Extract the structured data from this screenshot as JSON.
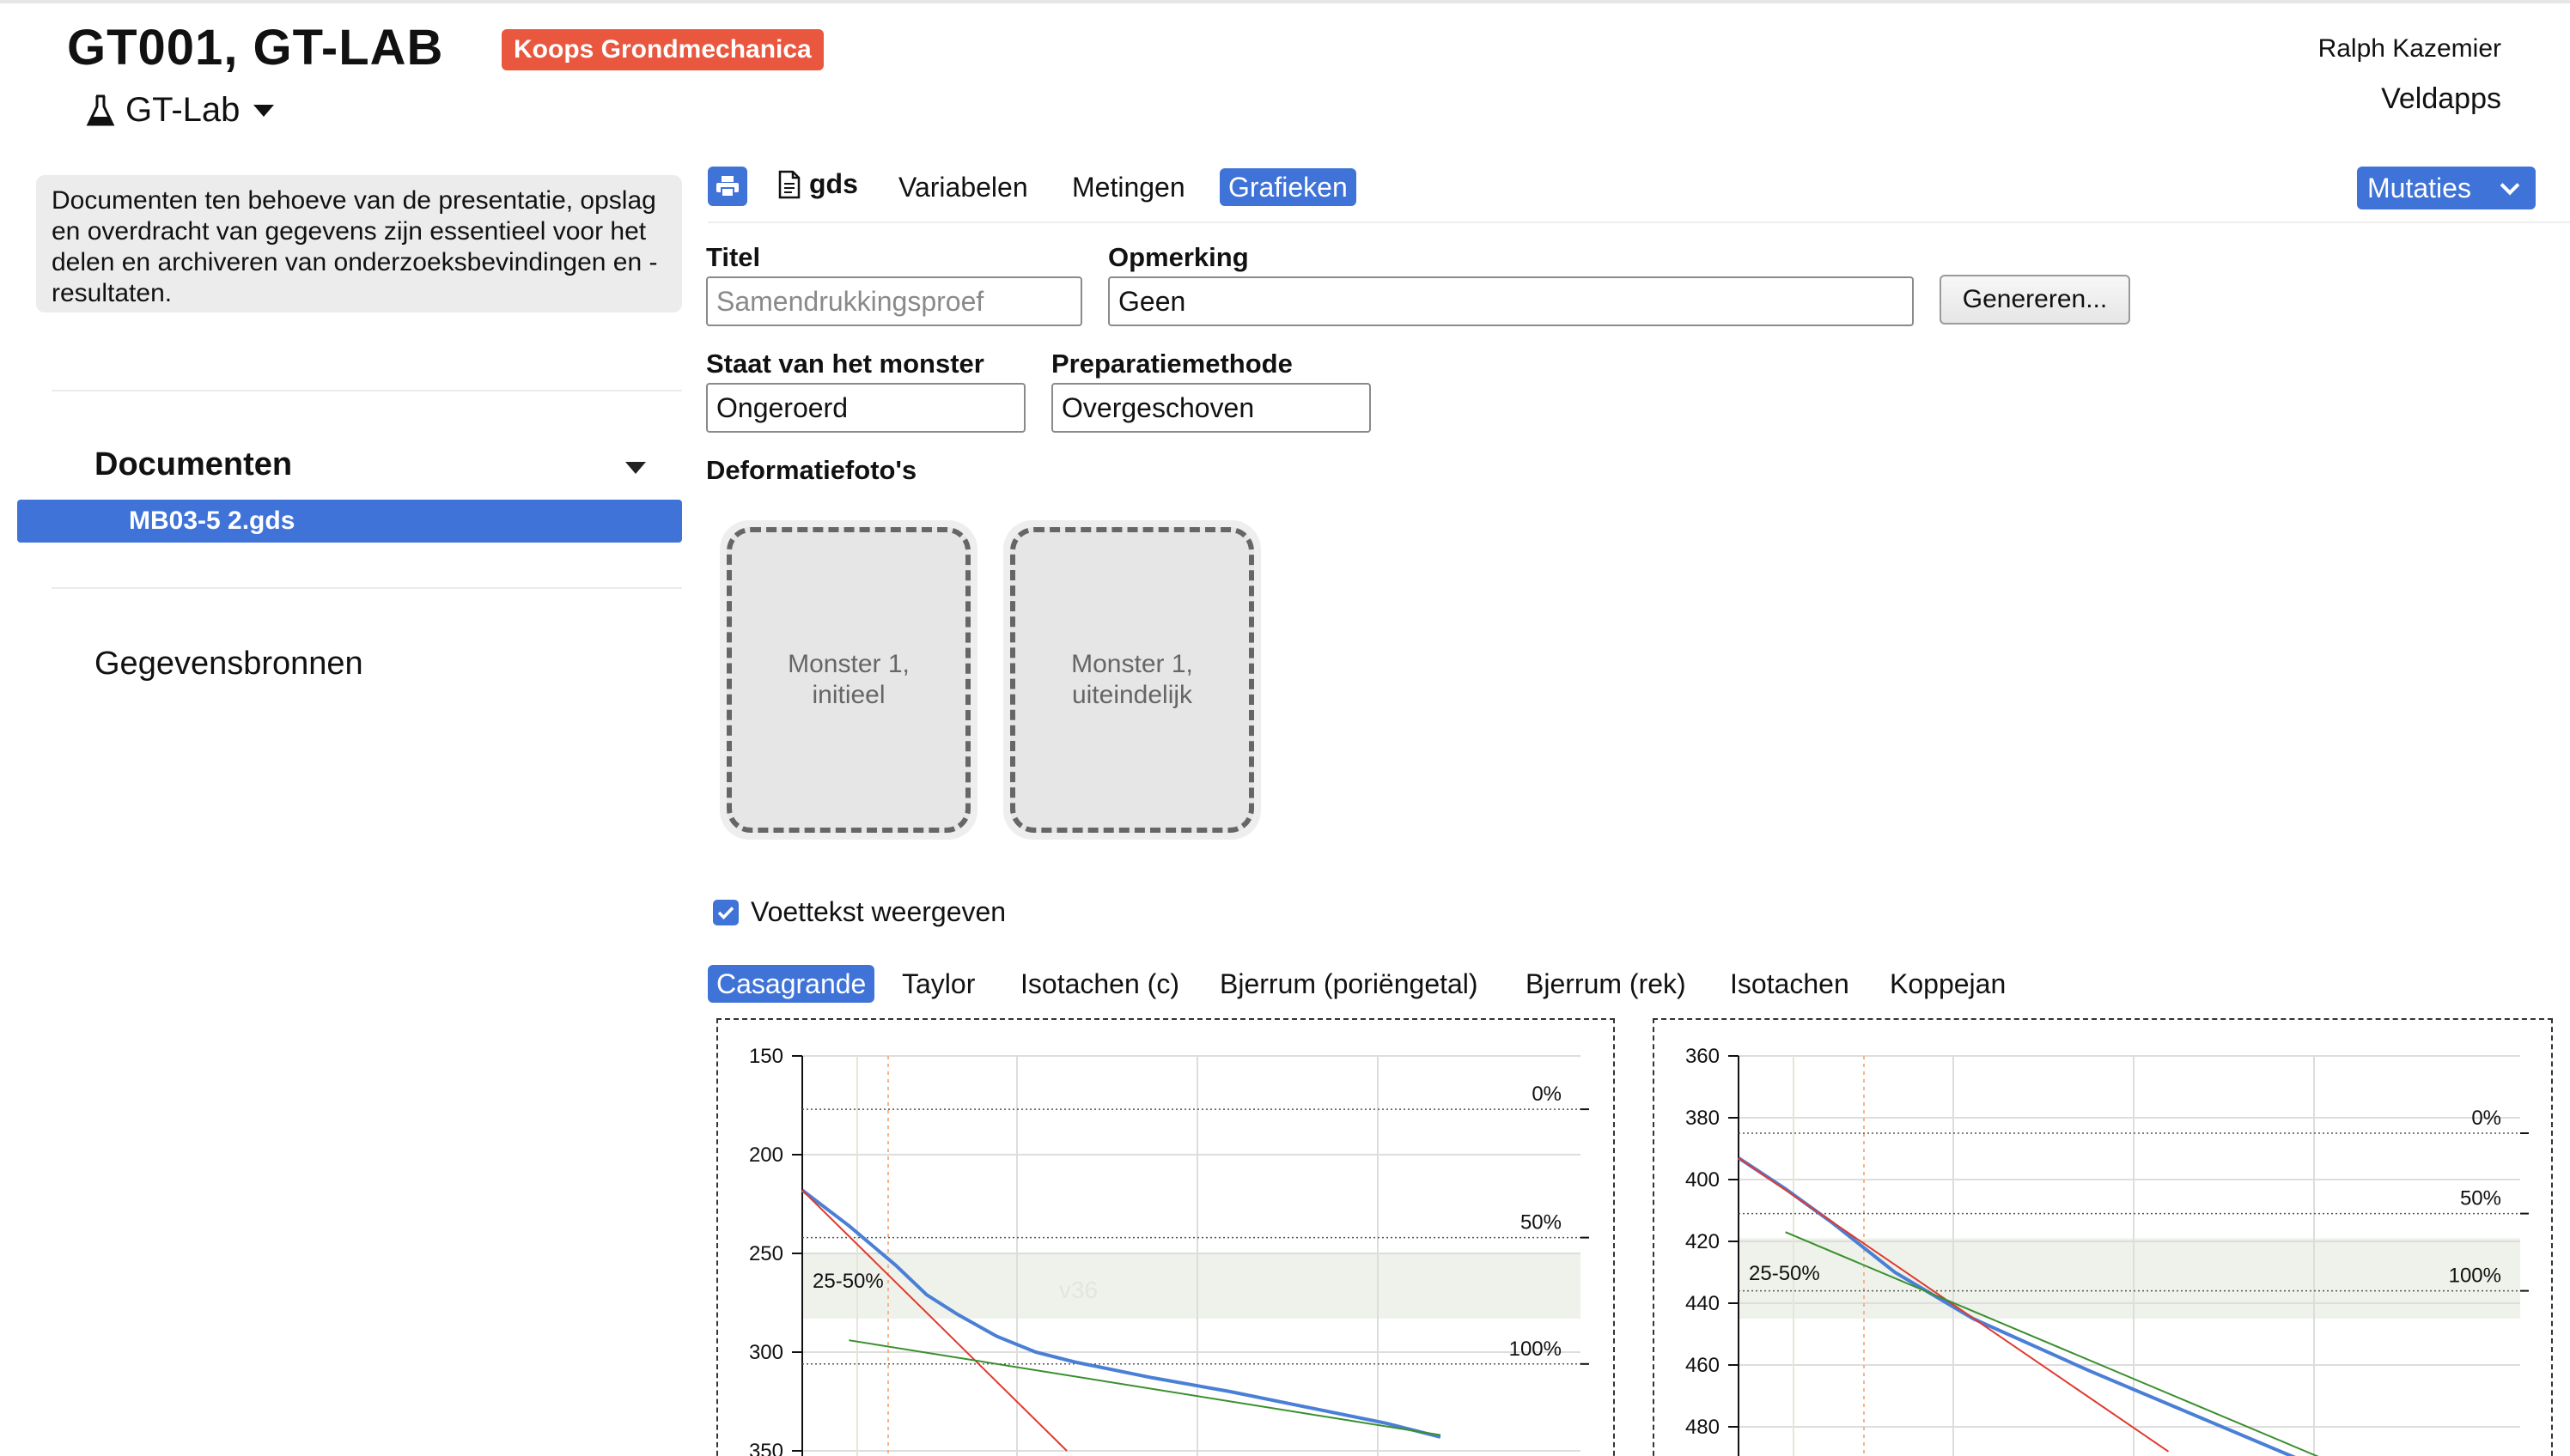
{
  "header": {
    "title": "GT001, GT-LAB",
    "badge": "Koops Grondmechanica",
    "module": "GT-Lab",
    "user": "Ralph Kazemier",
    "brand": "Veldapps"
  },
  "sidebar": {
    "info": "Documenten ten behoeve van de presentatie, opslag en overdracht van gegevens zijn essentieel voor het delen en archiveren van onderzoeksbevindingen en -resultaten.",
    "documents_header": "Documenten",
    "documents": [
      "MB03-5 2.gds"
    ],
    "sources": "Gegevensbronnen"
  },
  "toolbar": {
    "print_icon": "printer-icon",
    "file_tab": "gds",
    "tabs": [
      "Variabelen",
      "Metingen",
      "Grafieken"
    ],
    "active_tab": "Grafieken",
    "mutations": "Mutaties"
  },
  "form": {
    "title_label": "Titel",
    "title_placeholder": "Samendrukkingsproef",
    "remark_label": "Opmerking",
    "remark_value": "Geen",
    "generate_button": "Genereren...",
    "state_label": "Staat van het monster",
    "state_value": "Ongeroerd",
    "prep_label": "Preparatiemethode",
    "prep_value": "Overgeschoven",
    "photos_label": "Deformatiefoto's",
    "photos": [
      "Monster 1, initieel",
      "Monster 1, uiteindelijk"
    ],
    "footer_checkbox": "Voettekst weergeven",
    "footer_checked": true
  },
  "chart_tabs": {
    "items": [
      "Casagrande",
      "Taylor",
      "Isotachen (c)",
      "Bjerrum (poriëngetal)",
      "Bjerrum (rek)",
      "Isotachen",
      "Koppejan"
    ],
    "active": "Casagrande"
  },
  "colors": {
    "accent": "#3f73d8",
    "badge": "#e9573f",
    "curve": "#4a7fd6",
    "tangent_red": "#e03a2e",
    "tangent_green": "#3a8f2e"
  },
  "chart_data": [
    {
      "type": "line",
      "ylim": [
        150,
        350
      ],
      "y_inverted": true,
      "yticks": [
        150,
        200,
        250,
        300,
        350
      ],
      "annotation": "v36",
      "band_label": "25-50%",
      "ref_levels": [
        {
          "label": "0%",
          "value": 177
        },
        {
          "label": "50%",
          "value": 242
        },
        {
          "label": "100%",
          "value": 306
        }
      ],
      "band": [
        250,
        283
      ],
      "series": [
        {
          "role": "measurement",
          "x": [
            0.0,
            0.06,
            0.12,
            0.16,
            0.2,
            0.25,
            0.3,
            0.35,
            0.45,
            0.55,
            0.65,
            0.75,
            0.82
          ],
          "y": [
            218,
            236,
            256,
            271,
            281,
            292,
            300,
            305,
            313,
            320,
            328,
            336,
            343
          ]
        },
        {
          "role": "tangent-red",
          "x": [
            0.0,
            0.34
          ],
          "y": [
            218,
            350
          ]
        },
        {
          "role": "tangent-green",
          "x": [
            0.06,
            0.82
          ],
          "y": [
            294,
            342
          ]
        }
      ]
    },
    {
      "type": "line",
      "ylim": [
        360,
        480
      ],
      "y_inverted": true,
      "yticks": [
        360,
        380,
        400,
        420,
        440,
        460,
        480
      ],
      "band_label": "25-50%",
      "ref_levels": [
        {
          "label": "0%",
          "value": 385
        },
        {
          "label": "50%",
          "value": 411
        },
        {
          "label": "100%",
          "value": 436
        }
      ],
      "band": [
        419,
        445
      ],
      "series": [
        {
          "role": "measurement",
          "x": [
            0.0,
            0.06,
            0.12,
            0.2,
            0.3,
            0.45,
            0.6,
            0.75,
            0.82
          ],
          "y": [
            393,
            403,
            414,
            430,
            445,
            462,
            478,
            494,
            500
          ]
        },
        {
          "role": "tangent-red",
          "x": [
            0.0,
            0.55
          ],
          "y": [
            393,
            488
          ]
        },
        {
          "role": "tangent-green",
          "x": [
            0.06,
            0.82
          ],
          "y": [
            417,
            498
          ]
        }
      ]
    }
  ]
}
